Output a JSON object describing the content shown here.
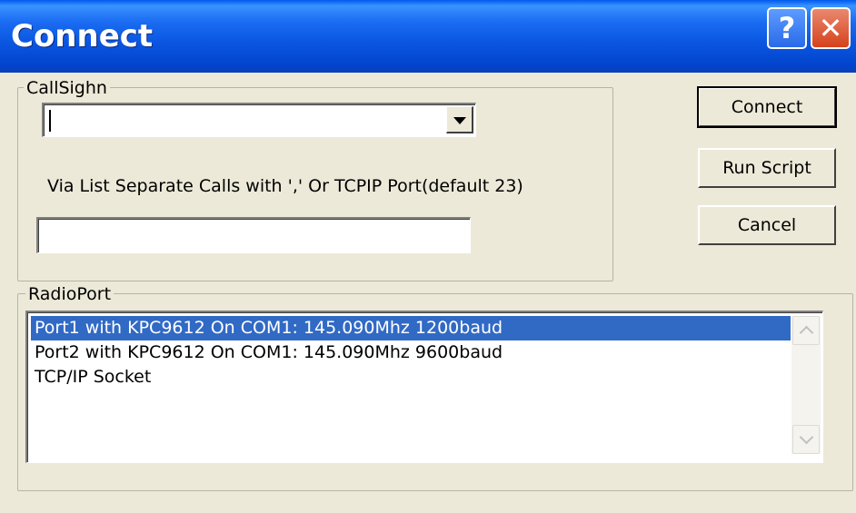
{
  "window": {
    "title": "Connect"
  },
  "titlebar_buttons": {
    "help_icon": "?",
    "close_icon": "✕"
  },
  "callsign": {
    "legend": "CallSighn",
    "combo_value": "",
    "via_label": "Via List Separate Calls with ',' Or TCPIP Port(default 23)",
    "via_value": ""
  },
  "buttons": {
    "connect": "Connect",
    "run_script": "Run Script",
    "cancel": "Cancel"
  },
  "radioport": {
    "legend": "RadioPort",
    "items": [
      "Port1 with KPC9612 On COM1: 145.090Mhz 1200baud",
      "Port2 with KPC9612 On COM1: 145.090Mhz 9600baud",
      "TCP/IP Socket"
    ],
    "selected_index": 0
  },
  "colors": {
    "titlebar": "#0a55e0",
    "dialog_bg": "#ece9d8",
    "selection": "#316ac5",
    "close_button": "#d6421c"
  }
}
